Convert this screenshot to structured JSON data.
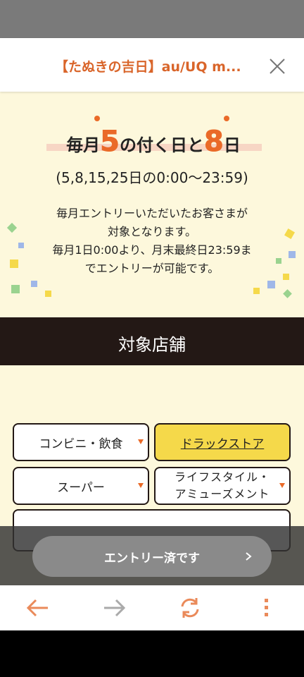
{
  "header": {
    "title": "【たぬきの吉日】au/UQ m...",
    "close_label": "閉じる"
  },
  "hero": {
    "title_part1": "毎月",
    "title_num1": "5",
    "title_part2": "の付く日と",
    "title_num2": "8",
    "title_part3": "日",
    "hours": "(5,8,15,25日の0:00〜23:59)",
    "description_line1": "毎月エントリーいただいたお客さまが",
    "description_line2": "対象となります。",
    "description_line3": "毎月1日0:00より、月末最終日23:59ま",
    "description_line4": "でエントリーが可能です。"
  },
  "section": {
    "title": "対象店舗"
  },
  "categories": [
    {
      "label": "コンビニ・飲食",
      "active": false
    },
    {
      "label": "ドラックストア",
      "active": true
    },
    {
      "label": "スーパー",
      "active": false
    },
    {
      "label_line1": "ライフスタイル・",
      "label_line2": "アミューズメント",
      "active": false
    }
  ],
  "entry_button": {
    "label": "エントリー済です"
  },
  "colors": {
    "accent": "#ea6a28",
    "title_orange": "#d9652a",
    "background": "#fdf8dc",
    "banner": "#231815",
    "active_tab": "#f5d94a",
    "entry_button": "#8a8a8a"
  },
  "bottom_nav": {
    "icons": [
      "back-arrow-icon",
      "forward-arrow-icon",
      "reload-icon",
      "more-vertical-icon"
    ]
  }
}
